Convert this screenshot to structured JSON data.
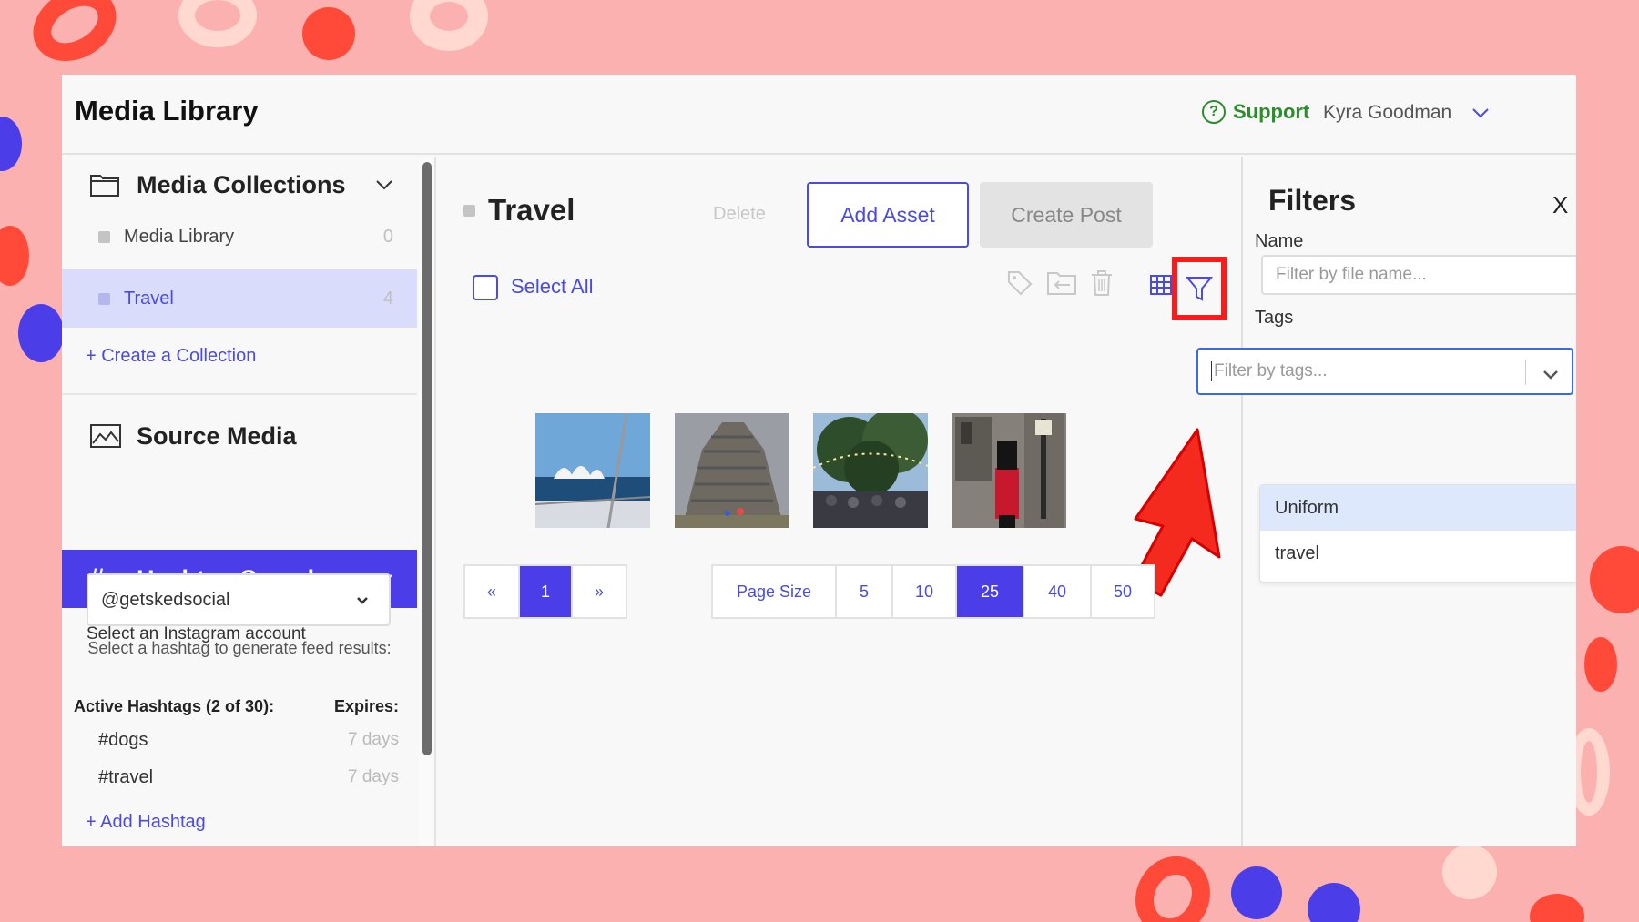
{
  "app": {
    "title": "Media Library",
    "support_label": "Support",
    "user_name": "Kyra Goodman"
  },
  "sidebar": {
    "collections_header": "Media Collections",
    "collections": [
      {
        "name": "Media Library",
        "count": "0",
        "active": false
      },
      {
        "name": "Travel",
        "count": "4",
        "active": true
      }
    ],
    "create_collection": "+ Create a Collection",
    "source_media": "Source Media",
    "hashtag_search": "Hashtag Search",
    "select_account_label": "Select an Instagram account",
    "account_value": "@getskedsocial",
    "hint": "Select a hashtag to generate feed results:",
    "active_hashtags_label": "Active Hashtags (2 of 30):",
    "expires_label": "Expires:",
    "hashtags": [
      {
        "tag": "#dogs",
        "expires": "7 days"
      },
      {
        "tag": "#travel",
        "expires": "7 days"
      }
    ],
    "add_hashtag": "+ Add Hashtag"
  },
  "main": {
    "collection_title": "Travel",
    "delete_label": "Delete",
    "add_asset_label": "Add Asset",
    "create_post_label": "Create Post",
    "select_all_label": "Select All",
    "pager": [
      "«",
      "1",
      "»"
    ],
    "page_size_label": "Page Size",
    "page_sizes": [
      "5",
      "10",
      "25",
      "40",
      "50"
    ],
    "selected_page_size": "25"
  },
  "filters": {
    "title": "Filters",
    "close": "X",
    "name_label": "Name",
    "name_placeholder": "Filter by file name...",
    "tags_label": "Tags",
    "tags_placeholder": "Filter by tags...",
    "tag_options": [
      "Uniform",
      "travel"
    ]
  },
  "colors": {
    "accent": "#4b3ee8",
    "support_green": "#2e8b2e",
    "highlight_red": "#ff1a1a",
    "background_pink": "#fcb1b1"
  }
}
